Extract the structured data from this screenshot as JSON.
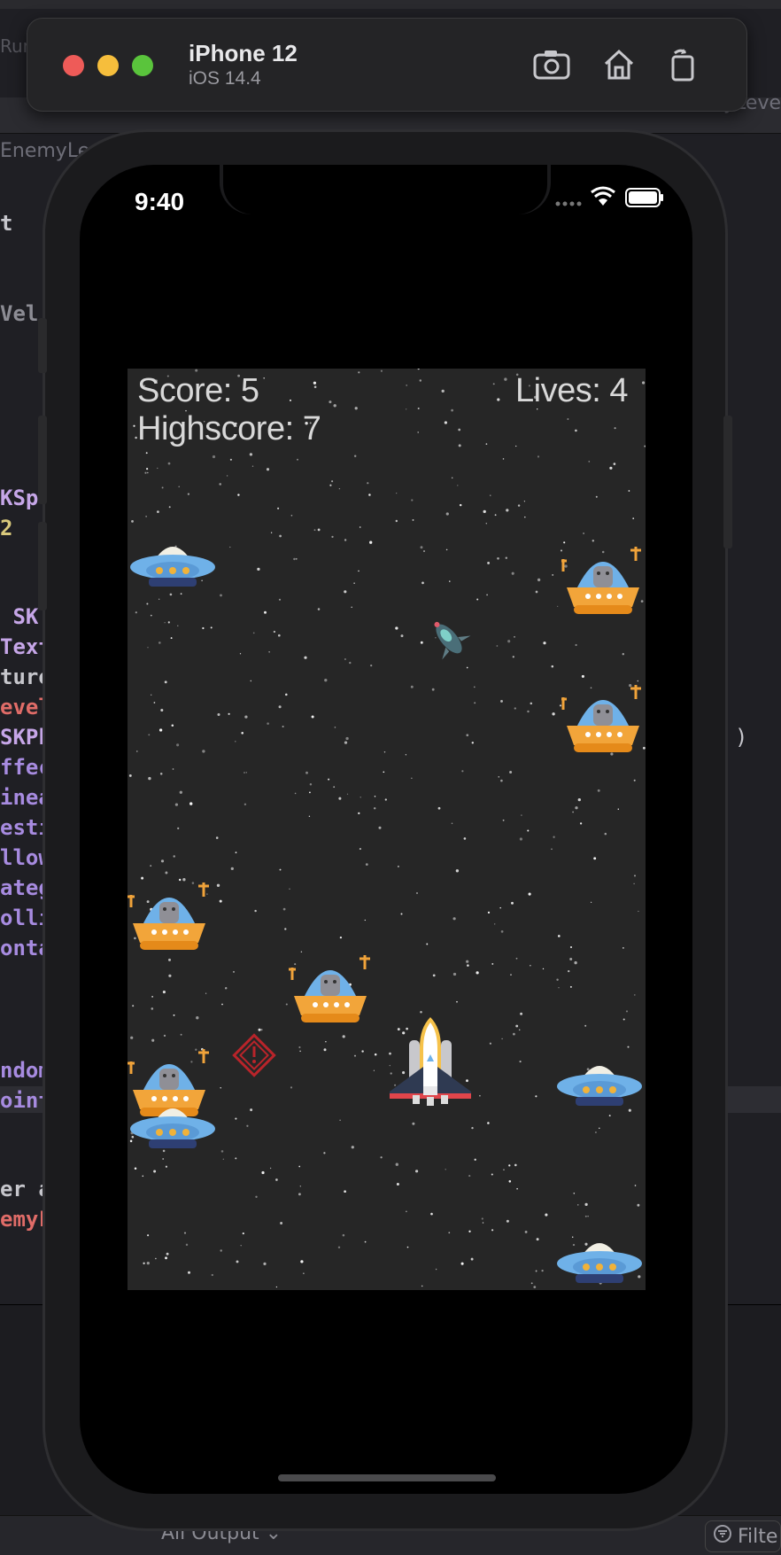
{
  "simulator": {
    "device": "iPhone 12",
    "os": "iOS 14.4",
    "buttons": [
      "screenshot-icon",
      "home-icon",
      "rotate-icon"
    ]
  },
  "status_bar": {
    "time": "9:40",
    "icons": [
      "signal-dots-icon",
      "wifi-icon",
      "battery-icon"
    ]
  },
  "game": {
    "score_text": "Score: 5",
    "highscore_text": "Highscore: 7",
    "lives_text": "Lives: 4",
    "background_color": "#262626",
    "sprites": [
      "ufo-saucer",
      "alien-ufo",
      "space-shuttle",
      "alien-ship",
      "warning-sign"
    ]
  },
  "xcode": {
    "run_text": "Run",
    "tab_left": "EnemyLev",
    "tab_right": "yLeve",
    "code_fragments": [
      {
        "text": "t",
        "color": "#c6c6cc"
      },
      {
        "text": "Vel",
        "color": "#8c8c94"
      },
      {
        "text": "KSp",
        "color": "#c6a6e8"
      },
      {
        "text": "2",
        "color": "#d9c97c"
      },
      {
        "text": " SK",
        "color": "#c6a6e8"
      },
      {
        "text": "Text",
        "color": "#c6a6e8"
      },
      {
        "text": "ture",
        "color": "#c6c6cc"
      },
      {
        "text": "evel",
        "color": "#e06c68"
      },
      {
        "text": "SKPh",
        "color": "#c6a6e8"
      },
      {
        "text": "ffec",
        "color": "#a78be0"
      },
      {
        "text": "inea",
        "color": "#a78be0"
      },
      {
        "text": "esti",
        "color": "#a78be0"
      },
      {
        "text": "llow",
        "color": "#a78be0"
      },
      {
        "text": "ateg",
        "color": "#a78be0"
      },
      {
        "text": "olli",
        "color": "#a78be0"
      },
      {
        "text": "onta",
        "color": "#a78be0"
      },
      {
        "text": "ndom",
        "color": "#a78be0"
      },
      {
        "text": "oint",
        "color": "#a78be0"
      },
      {
        "text": "er a",
        "color": "#c6c6cc"
      },
      {
        "text": "emyL",
        "color": "#e06c68"
      }
    ],
    "right_paren": ")",
    "output_label": "All Output ⌄",
    "filter_label": "Filte"
  }
}
